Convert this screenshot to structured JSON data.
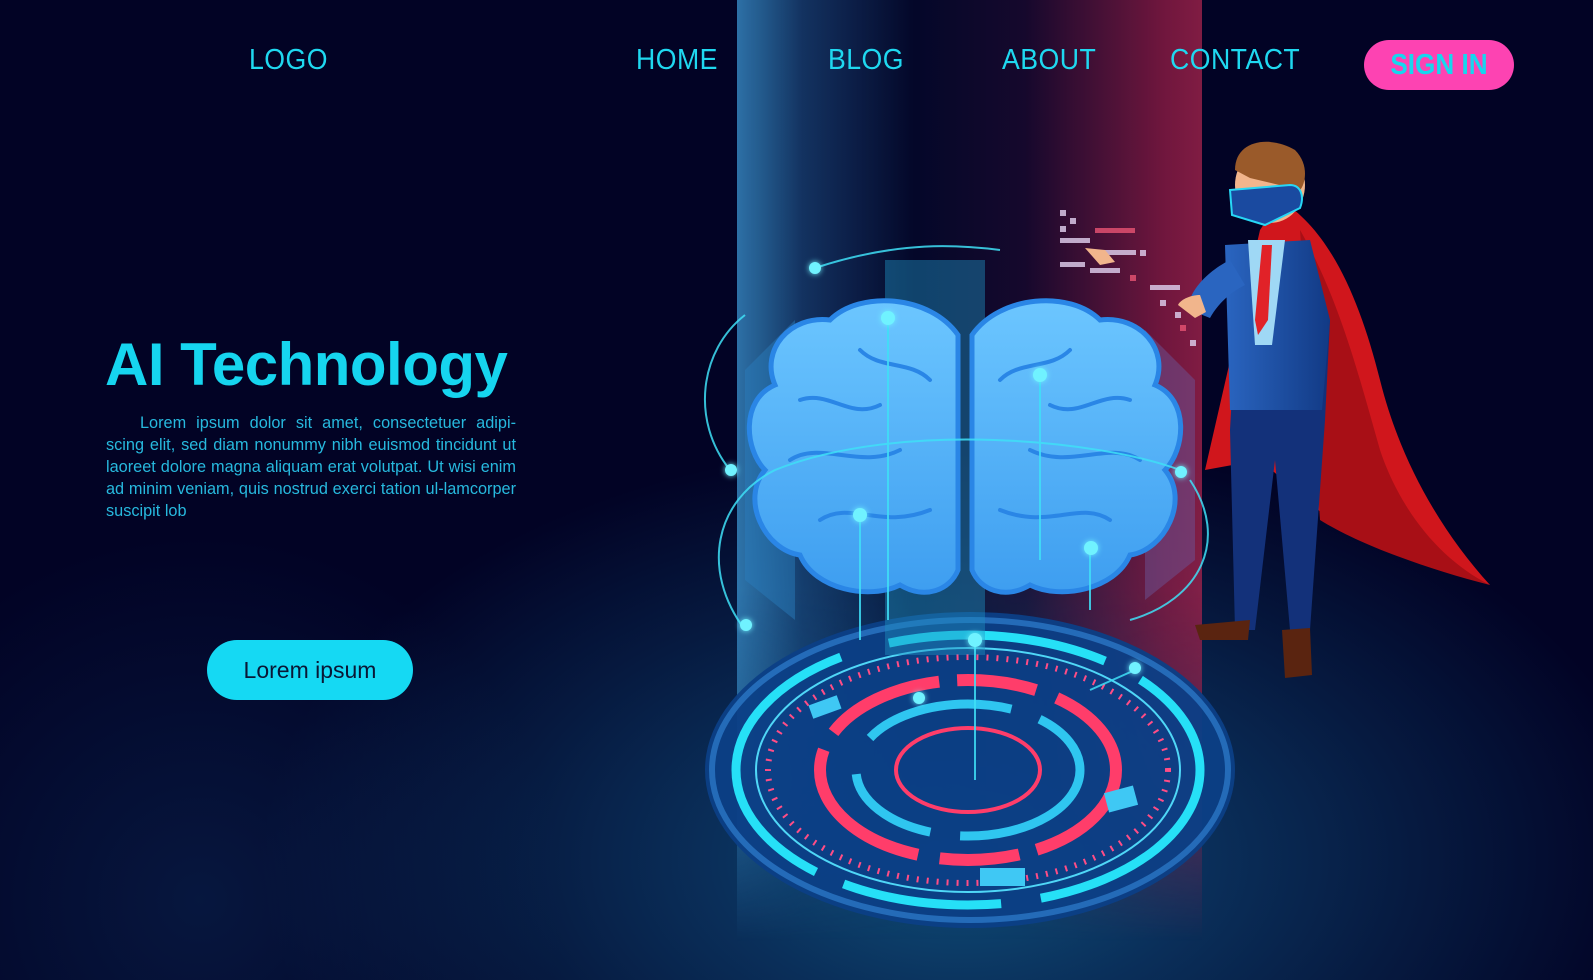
{
  "header": {
    "logo_label": "LOGO",
    "nav": [
      {
        "label": "HOME"
      },
      {
        "label": "BLOG"
      },
      {
        "label": "ABOUT"
      },
      {
        "label": "CONTACT"
      }
    ],
    "sign_in_label": "SIGN IN"
  },
  "hero": {
    "title": "AI Technology",
    "body": "Lorem ipsum dolor sit amet, consectetuer adipi-scing elit, sed diam nonummy nibh euismod tincidunt ut laoreet dolore magna aliquam erat volutpat. Ut wisi enim ad minim veniam, quis nostrud exerci tation ul-lamcorper suscipit lob",
    "cta_label": "Lorem ipsum"
  },
  "illustration": {
    "subject": "businessman with VR headset and red cape touching holographic interface beside a glowing brain above a circular HUD platform",
    "colors": {
      "background": "#020325",
      "accent_cyan": "#16d5ef",
      "accent_pink": "#fd43b2",
      "hud_red": "#ff3d6a",
      "brain_blue": "#4fb0f5",
      "cape_red": "#d0161c"
    }
  }
}
